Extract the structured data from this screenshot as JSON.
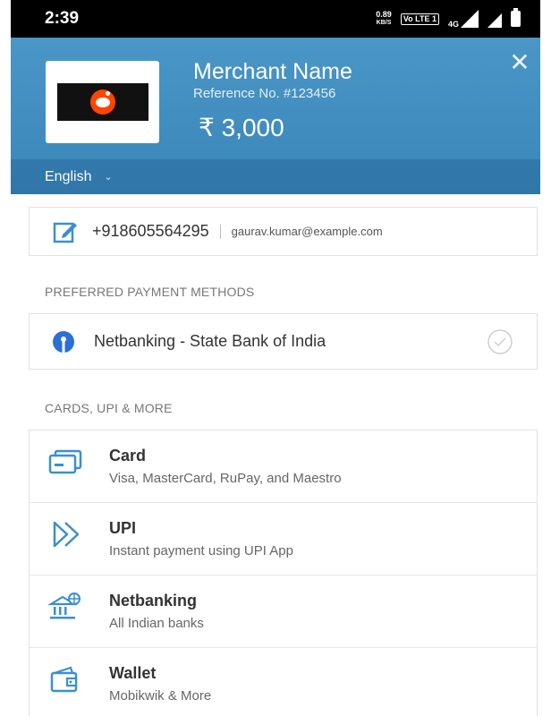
{
  "statusbar": {
    "time": "2:39",
    "speed_value": "0.89",
    "speed_unit": "KB/S",
    "volte": "Vo LTE 1",
    "network": "4G"
  },
  "header": {
    "merchant_name": "Merchant Name",
    "reference": "Reference No. #123456",
    "amount": "₹ 3,000",
    "language": "English",
    "close_symbol": "✕",
    "chevron_symbol": "⌄"
  },
  "contact": {
    "phone": "+918605564295",
    "email": "gaurav.kumar@example.com"
  },
  "sections": {
    "preferred": "PREFERRED PAYMENT METHODS",
    "more": "CARDS, UPI & MORE"
  },
  "preferred_method": {
    "label": "Netbanking - State Bank of India"
  },
  "methods": [
    {
      "title": "Card",
      "subtitle": "Visa, MasterCard, RuPay, and Maestro",
      "icon": "card-icon"
    },
    {
      "title": "UPI",
      "subtitle": "Instant payment using UPI App",
      "icon": "upi-icon"
    },
    {
      "title": "Netbanking",
      "subtitle": "All Indian banks",
      "icon": "bank-icon"
    },
    {
      "title": "Wallet",
      "subtitle": "Mobikwik & More",
      "icon": "wallet-icon"
    }
  ],
  "colors": {
    "header_bg": "#4a96c7",
    "icon_accent": "#3b8fd0",
    "sbi_blue": "#2a6fd6"
  }
}
